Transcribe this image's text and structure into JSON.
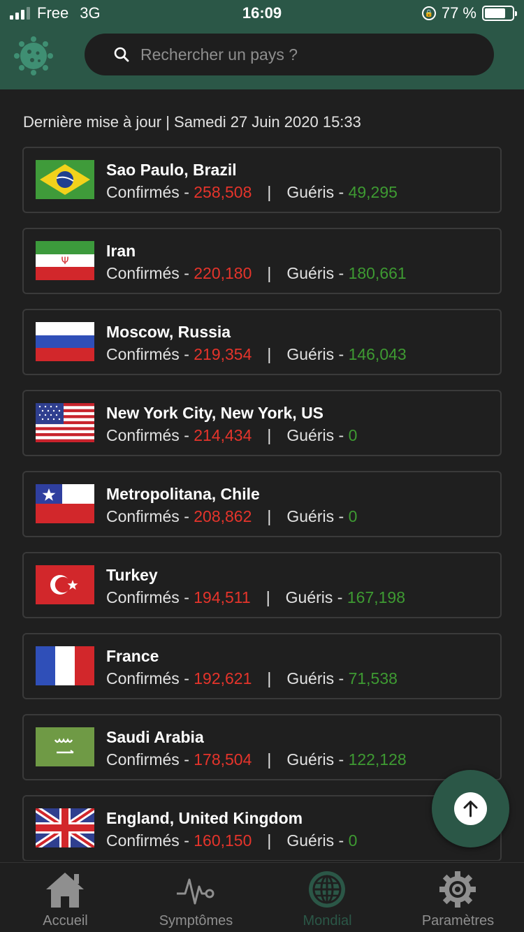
{
  "status_bar": {
    "carrier": "Free",
    "network": "3G",
    "time": "16:09",
    "battery": "77 %",
    "battery_level": 0.77
  },
  "search": {
    "placeholder": "Rechercher un pays ?"
  },
  "last_update": "Dernière mise à jour | Samedi 27 Juin 2020 15:33",
  "labels": {
    "confirmed": "Confirmés - ",
    "recovered": "Guéris - ",
    "separator": "|"
  },
  "countries": [
    {
      "name": "Sao Paulo, Brazil",
      "flag": "brazil-flag",
      "confirmed": "258,508",
      "recovered": "49,295"
    },
    {
      "name": "Iran",
      "flag": "iran-flag",
      "confirmed": "220,180",
      "recovered": "180,661"
    },
    {
      "name": "Moscow, Russia",
      "flag": "russia-flag",
      "confirmed": "219,354",
      "recovered": "146,043"
    },
    {
      "name": "New York City, New York, US",
      "flag": "usa-flag",
      "confirmed": "214,434",
      "recovered": "0"
    },
    {
      "name": "Metropolitana, Chile",
      "flag": "chile-flag",
      "confirmed": "208,862",
      "recovered": "0"
    },
    {
      "name": "Turkey",
      "flag": "turkey-flag",
      "confirmed": "194,511",
      "recovered": "167,198"
    },
    {
      "name": "France",
      "flag": "france-flag",
      "confirmed": "192,621",
      "recovered": "71,538"
    },
    {
      "name": "Saudi Arabia",
      "flag": "saudi-arabia-flag",
      "confirmed": "178,504",
      "recovered": "122,128"
    },
    {
      "name": "England, United Kingdom",
      "flag": "uk-flag",
      "confirmed": "160,150",
      "recovered": "0"
    }
  ],
  "tabs": [
    {
      "label": "Accueil",
      "icon": "home-icon"
    },
    {
      "label": "Symptômes",
      "icon": "heartbeat-icon"
    },
    {
      "label": "Mondial",
      "icon": "globe-icon",
      "active": true
    },
    {
      "label": "Paramètres",
      "icon": "gear-icon"
    }
  ],
  "colors": {
    "header": "#2b5747",
    "background": "#1f1f1f",
    "confirmed": "#e5342b",
    "recovered": "#3e9a32",
    "tab_inactive": "#8f8f8f",
    "tab_active": "#2b5747"
  }
}
